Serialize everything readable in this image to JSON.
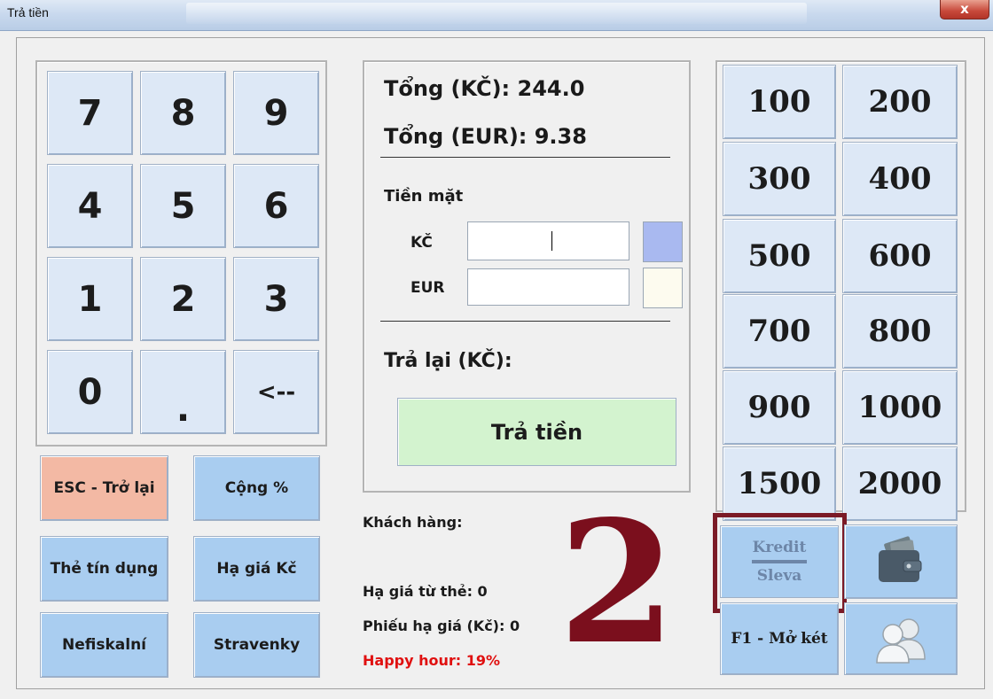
{
  "window": {
    "title": "Trả tiền",
    "close_label": "x"
  },
  "keypad": {
    "keys": [
      "7",
      "8",
      "9",
      "4",
      "5",
      "6",
      "1",
      "2",
      "3",
      "0",
      ".",
      "<--"
    ]
  },
  "actions": {
    "esc": "ESC - Trở lại",
    "add_percent": "Cộng %",
    "credit_card": "Thẻ tín dụng",
    "discount_kc": "Hạ giá Kč",
    "nonfiscal": "Nefiskalní",
    "stravenky": "Stravenky"
  },
  "summary": {
    "total_kc": "Tổng (KČ): 244.0",
    "total_eur": "Tổng (EUR): 9.38",
    "cash_label": "Tiền mặt",
    "kc_label": "KČ",
    "eur_label": "EUR",
    "kc_value": "",
    "eur_value": "",
    "change_label": "Trả lại (KČ):",
    "pay_button": "Trả tiền"
  },
  "customer": {
    "label": "Khách hàng:",
    "card_discount": "Hạ giá từ thẻ: 0",
    "voucher_discount": "Phiếu hạ giá (Kč): 0",
    "happy_hour": "Happy hour: 19%"
  },
  "annotation_number": "2",
  "denominations": [
    "100",
    "200",
    "300",
    "400",
    "500",
    "600",
    "700",
    "800",
    "900",
    "1000",
    "1500",
    "2000"
  ],
  "extra_buttons": {
    "kredit": "Kredit",
    "sleva": "Sleva",
    "open_drawer": "F1 - Mở két"
  },
  "colors": {
    "kc_swatch": "#a9b9f0",
    "eur_swatch": "#fdfbef",
    "happy_hour": "#e01010",
    "annotation": "#7b0f1d",
    "pay_button": "#d3f3cf",
    "esc_button": "#f3b9a4"
  },
  "icons": {
    "wallet": "wallet-icon",
    "users": "users-icon"
  }
}
